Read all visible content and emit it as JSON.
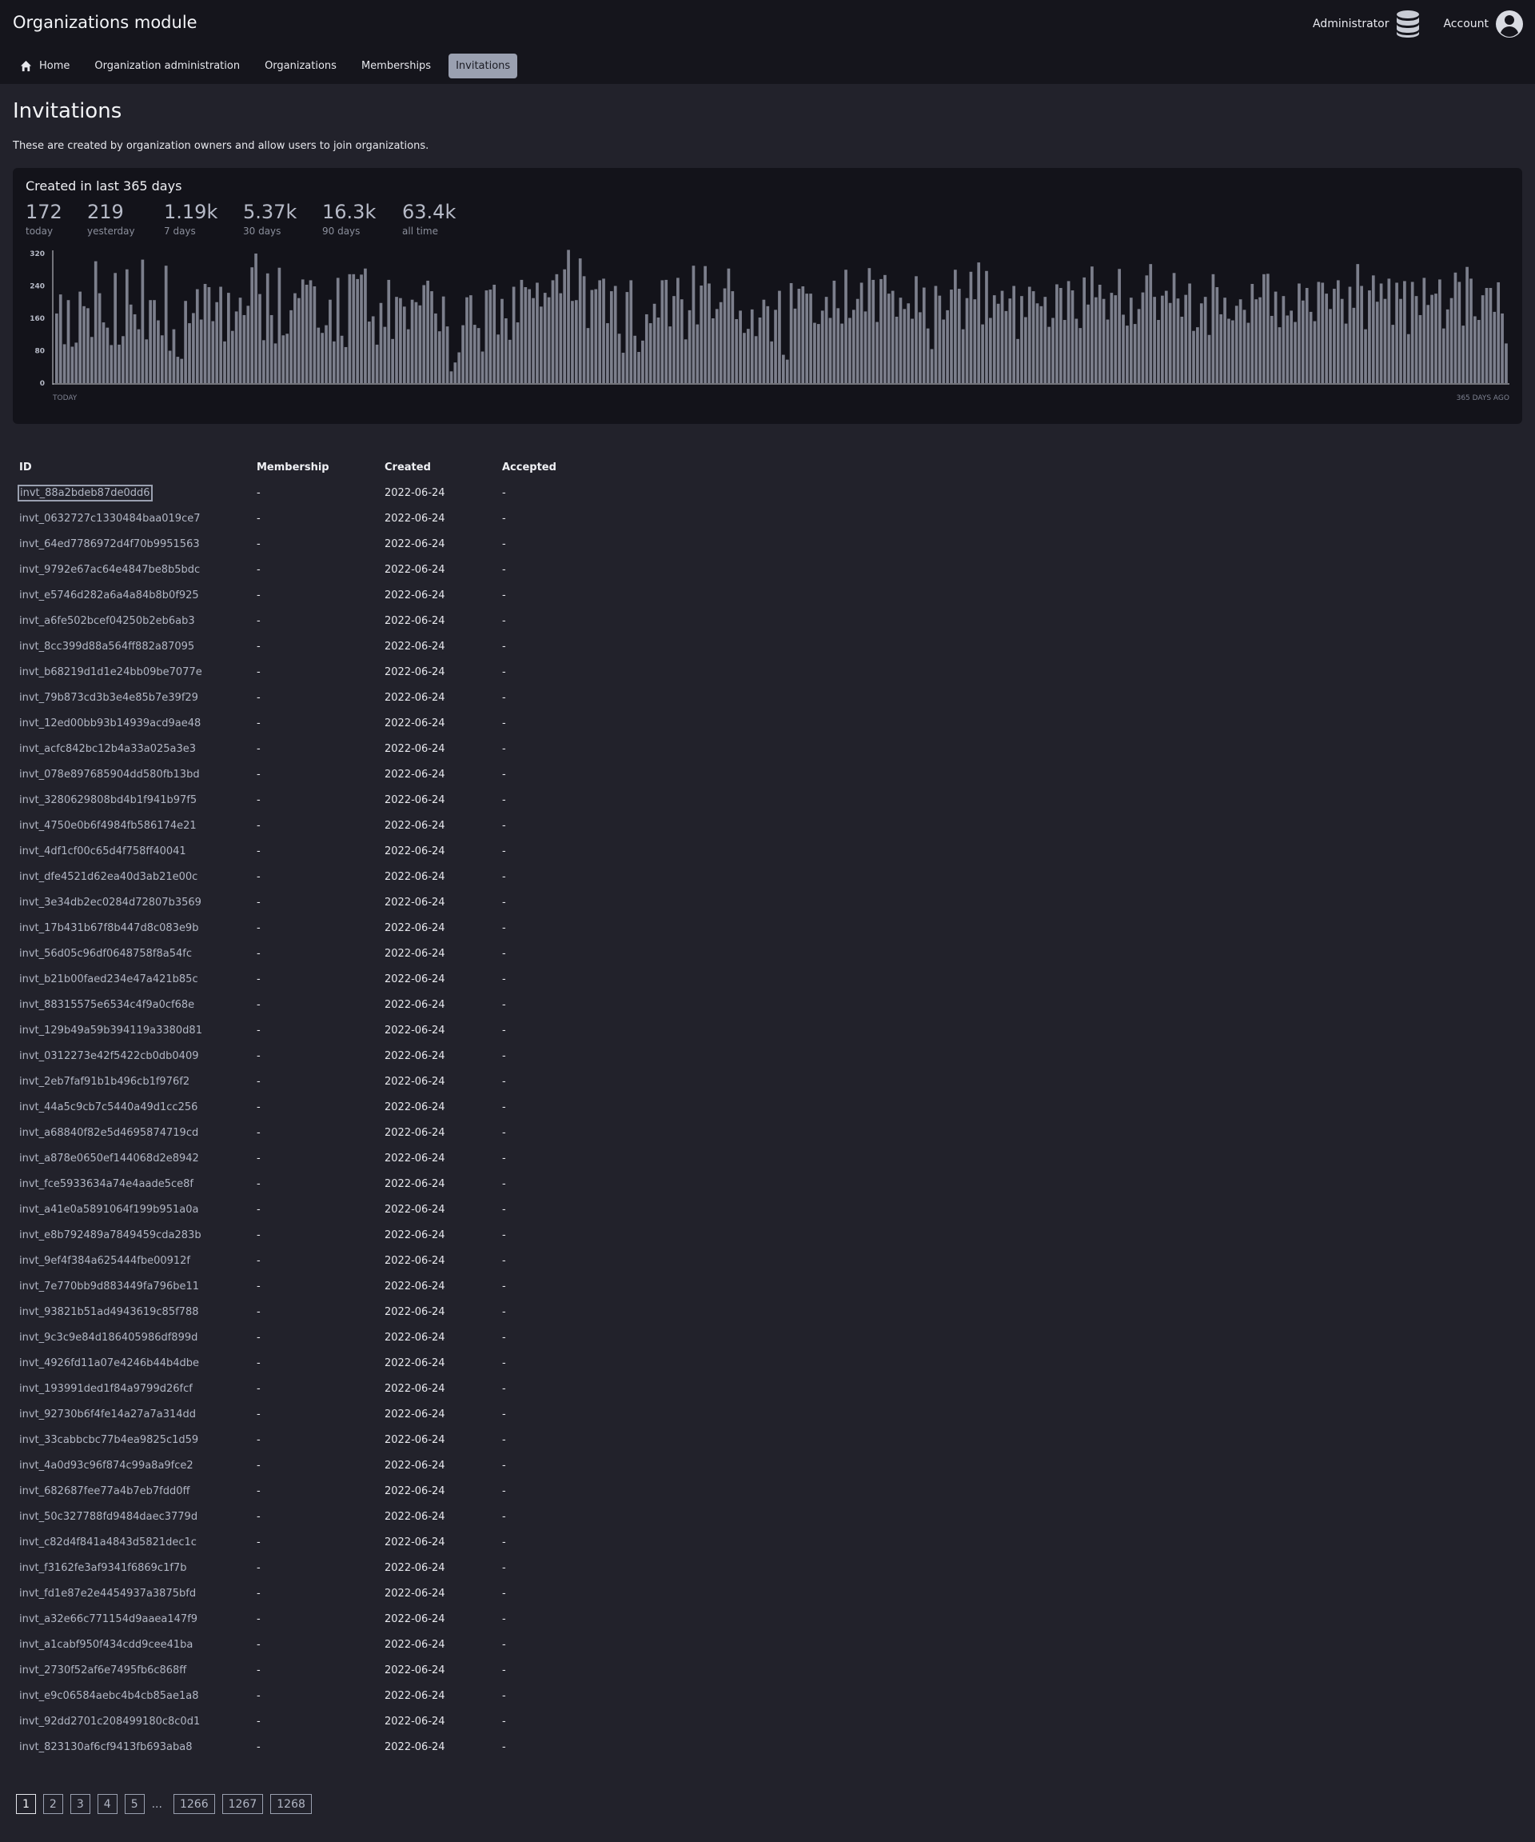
{
  "app": {
    "title": "Organizations module",
    "admin_label": "Administrator",
    "account_label": "Account"
  },
  "nav": {
    "tabs": [
      {
        "label": "Home",
        "icon": "home-icon",
        "active": false
      },
      {
        "label": "Organization administration",
        "active": false
      },
      {
        "label": "Organizations",
        "active": false
      },
      {
        "label": "Memberships",
        "active": false
      },
      {
        "label": "Invitations",
        "active": true
      }
    ]
  },
  "page": {
    "title": "Invitations",
    "description": "These are created by organization owners and allow users to join organizations."
  },
  "stats": {
    "title": "Created in last 365 days",
    "items": [
      {
        "value": "172",
        "label": "today"
      },
      {
        "value": "219",
        "label": "yesterday"
      },
      {
        "value": "1.19k",
        "label": "7 days"
      },
      {
        "value": "5.37k",
        "label": "30 days"
      },
      {
        "value": "16.3k",
        "label": "90 days"
      },
      {
        "value": "63.4k",
        "label": "all time"
      }
    ]
  },
  "chart_data": {
    "type": "bar",
    "x_start_label": "TODAY",
    "x_end_label": "365 DAYS AGO",
    "yticks": [
      0,
      80,
      160,
      240,
      320
    ],
    "ylim": [
      0,
      320
    ],
    "values": [
      172,
      219,
      96,
      205,
      90,
      100,
      226,
      190,
      185,
      114,
      301,
      222,
      150,
      137,
      94,
      272,
      95,
      116,
      281,
      194,
      170,
      133,
      305,
      108,
      205,
      205,
      155,
      118,
      290,
      80,
      133,
      65,
      60,
      203,
      148,
      173,
      232,
      157,
      245,
      237,
      153,
      200,
      238,
      103,
      223,
      129,
      177,
      211,
      168,
      191,
      286,
      320,
      220,
      106,
      271,
      168,
      98,
      285,
      118,
      122,
      180,
      222,
      210,
      256,
      243,
      254,
      239,
      137,
      124,
      143,
      206,
      103,
      260,
      117,
      89,
      269,
      269,
      257,
      268,
      283,
      152,
      165,
      95,
      198,
      139,
      255,
      109,
      213,
      210,
      189,
      133,
      206,
      200,
      192,
      242,
      253,
      227,
      172,
      128,
      214,
      140,
      29,
      51,
      76,
      143,
      212,
      217,
      144,
      136,
      78,
      229,
      231,
      243,
      120,
      208,
      160,
      107,
      238,
      150,
      255,
      237,
      232,
      210,
      248,
      189,
      223,
      212,
      254,
      269,
      222,
      281,
      329,
      203,
      205,
      308,
      264,
      136,
      230,
      232,
      254,
      258,
      148,
      227,
      240,
      122,
      75,
      225,
      254,
      117,
      77,
      105,
      170,
      148,
      196,
      162,
      254,
      255,
      140,
      215,
      260,
      207,
      108,
      180,
      290,
      145,
      241,
      289,
      246,
      160,
      183,
      200,
      234,
      283,
      227,
      158,
      179,
      124,
      134,
      182,
      116,
      162,
      206,
      190,
      103,
      181,
      228,
      70,
      58,
      247,
      184,
      233,
      239,
      221,
      221,
      149,
      146,
      179,
      213,
      161,
      253,
      185,
      147,
      280,
      161,
      181,
      208,
      248,
      177,
      284,
      255,
      151,
      257,
      267,
      221,
      228,
      164,
      211,
      183,
      197,
      159,
      264,
      175,
      236,
      135,
      84,
      240,
      216,
      157,
      180,
      231,
      280,
      233,
      133,
      210,
      275,
      207,
      298,
      145,
      277,
      161,
      217,
      196,
      228,
      178,
      209,
      240,
      109,
      215,
      163,
      238,
      227,
      197,
      190,
      213,
      139,
      161,
      244,
      235,
      156,
      252,
      229,
      159,
      136,
      261,
      194,
      288,
      212,
      243,
      208,
      157,
      223,
      217,
      282,
      169,
      142,
      211,
      146,
      183,
      224,
      266,
      294,
      213,
      156,
      216,
      228,
      198,
      272,
      209,
      164,
      218,
      246,
      129,
      138,
      197,
      213,
      119,
      269,
      237,
      170,
      211,
      159,
      155,
      191,
      207,
      181,
      149,
      245,
      207,
      212,
      269,
      270,
      166,
      226,
      138,
      215,
      167,
      179,
      151,
      246,
      204,
      235,
      176,
      153,
      250,
      248,
      221,
      183,
      233,
      254,
      208,
      147,
      238,
      186,
      294,
      240,
      133,
      229,
      266,
      201,
      246,
      208,
      258,
      144,
      248,
      208,
      252,
      121,
      250,
      215,
      168,
      260,
      193,
      218,
      221,
      256,
      135,
      182,
      210,
      273,
      250,
      142,
      287,
      258,
      165,
      156,
      217,
      235,
      235,
      176,
      249,
      172,
      98
    ]
  },
  "table": {
    "headers": [
      "ID",
      "Membership",
      "Created",
      "Accepted"
    ],
    "rows": [
      [
        "invt_88a2bdeb87de0dd6",
        "-",
        "2022-06-24",
        "-"
      ],
      [
        "invt_0632727c1330484baa019ce7",
        "-",
        "2022-06-24",
        "-"
      ],
      [
        "invt_64ed7786972d4f70b9951563",
        "-",
        "2022-06-24",
        "-"
      ],
      [
        "invt_9792e67ac64e4847be8b5bdc",
        "-",
        "2022-06-24",
        "-"
      ],
      [
        "invt_e5746d282a6a4a84b8b0f925",
        "-",
        "2022-06-24",
        "-"
      ],
      [
        "invt_a6fe502bcef04250b2eb6ab3",
        "-",
        "2022-06-24",
        "-"
      ],
      [
        "invt_8cc399d88a564ff882a87095",
        "-",
        "2022-06-24",
        "-"
      ],
      [
        "invt_b68219d1d1e24bb09be7077e",
        "-",
        "2022-06-24",
        "-"
      ],
      [
        "invt_79b873cd3b3e4e85b7e39f29",
        "-",
        "2022-06-24",
        "-"
      ],
      [
        "invt_12ed00bb93b14939acd9ae48",
        "-",
        "2022-06-24",
        "-"
      ],
      [
        "invt_acfc842bc12b4a33a025a3e3",
        "-",
        "2022-06-24",
        "-"
      ],
      [
        "invt_078e897685904dd580fb13bd",
        "-",
        "2022-06-24",
        "-"
      ],
      [
        "invt_3280629808bd4b1f941b97f5",
        "-",
        "2022-06-24",
        "-"
      ],
      [
        "invt_4750e0b6f4984fb586174e21",
        "-",
        "2022-06-24",
        "-"
      ],
      [
        "invt_4df1cf00c65d4f758ff40041",
        "-",
        "2022-06-24",
        "-"
      ],
      [
        "invt_dfe4521d62ea40d3ab21e00c",
        "-",
        "2022-06-24",
        "-"
      ],
      [
        "invt_3e34db2ec0284d72807b3569",
        "-",
        "2022-06-24",
        "-"
      ],
      [
        "invt_17b431b67f8b447d8c083e9b",
        "-",
        "2022-06-24",
        "-"
      ],
      [
        "invt_56d05c96df0648758f8a54fc",
        "-",
        "2022-06-24",
        "-"
      ],
      [
        "invt_b21b00faed234e47a421b85c",
        "-",
        "2022-06-24",
        "-"
      ],
      [
        "invt_88315575e6534c4f9a0cf68e",
        "-",
        "2022-06-24",
        "-"
      ],
      [
        "invt_129b49a59b394119a3380d81",
        "-",
        "2022-06-24",
        "-"
      ],
      [
        "invt_0312273e42f5422cb0db0409",
        "-",
        "2022-06-24",
        "-"
      ],
      [
        "invt_2eb7faf91b1b496cb1f976f2",
        "-",
        "2022-06-24",
        "-"
      ],
      [
        "invt_44a5c9cb7c5440a49d1cc256",
        "-",
        "2022-06-24",
        "-"
      ],
      [
        "invt_a68840f82e5d4695874719cd",
        "-",
        "2022-06-24",
        "-"
      ],
      [
        "invt_a878e0650ef144068d2e8942",
        "-",
        "2022-06-24",
        "-"
      ],
      [
        "invt_fce5933634a74e4aade5ce8f",
        "-",
        "2022-06-24",
        "-"
      ],
      [
        "invt_a41e0a5891064f199b951a0a",
        "-",
        "2022-06-24",
        "-"
      ],
      [
        "invt_e8b792489a7849459cda283b",
        "-",
        "2022-06-24",
        "-"
      ],
      [
        "invt_9ef4f384a625444fbe00912f",
        "-",
        "2022-06-24",
        "-"
      ],
      [
        "invt_7e770bb9d883449fa796be11",
        "-",
        "2022-06-24",
        "-"
      ],
      [
        "invt_93821b51ad4943619c85f788",
        "-",
        "2022-06-24",
        "-"
      ],
      [
        "invt_9c3c9e84d186405986df899d",
        "-",
        "2022-06-24",
        "-"
      ],
      [
        "invt_4926fd11a07e4246b44b4dbe",
        "-",
        "2022-06-24",
        "-"
      ],
      [
        "invt_193991ded1f84a9799d26fcf",
        "-",
        "2022-06-24",
        "-"
      ],
      [
        "invt_92730b6f4fe14a27a7a314dd",
        "-",
        "2022-06-24",
        "-"
      ],
      [
        "invt_33cabbcbc77b4ea9825c1d59",
        "-",
        "2022-06-24",
        "-"
      ],
      [
        "invt_4a0d93c96f874c99a8a9fce2",
        "-",
        "2022-06-24",
        "-"
      ],
      [
        "invt_682687fee77a4b7eb7fdd0ff",
        "-",
        "2022-06-24",
        "-"
      ],
      [
        "invt_50c327788fd9484daec3779d",
        "-",
        "2022-06-24",
        "-"
      ],
      [
        "invt_c82d4f841a4843d5821dec1c",
        "-",
        "2022-06-24",
        "-"
      ],
      [
        "invt_f3162fe3af9341f6869c1f7b",
        "-",
        "2022-06-24",
        "-"
      ],
      [
        "invt_fd1e87e2e4454937a3875bfd",
        "-",
        "2022-06-24",
        "-"
      ],
      [
        "invt_a32e66c771154d9aaea147f9",
        "-",
        "2022-06-24",
        "-"
      ],
      [
        "invt_a1cabf950f434cdd9cee41ba",
        "-",
        "2022-06-24",
        "-"
      ],
      [
        "invt_2730f52af6e7495fb6c868ff",
        "-",
        "2022-06-24",
        "-"
      ],
      [
        "invt_e9c06584aebc4b4cb85ae1a8",
        "-",
        "2022-06-24",
        "-"
      ],
      [
        "invt_92dd2701c208499180c8c0d1",
        "-",
        "2022-06-24",
        "-"
      ],
      [
        "invt_823130af6cf9413fb693aba8",
        "-",
        "2022-06-24",
        "-"
      ]
    ]
  },
  "pagination": {
    "pages": [
      "1",
      "2",
      "3",
      "4",
      "5"
    ],
    "ellipsis": "...",
    "last_pages": [
      "1266",
      "1267",
      "1268"
    ],
    "current": "1"
  },
  "colors": {
    "background": "#22222b",
    "topbar": "#15151c",
    "card": "#13131a",
    "bar": "#7c7f8c",
    "active_tab": "#9aa0b0"
  }
}
